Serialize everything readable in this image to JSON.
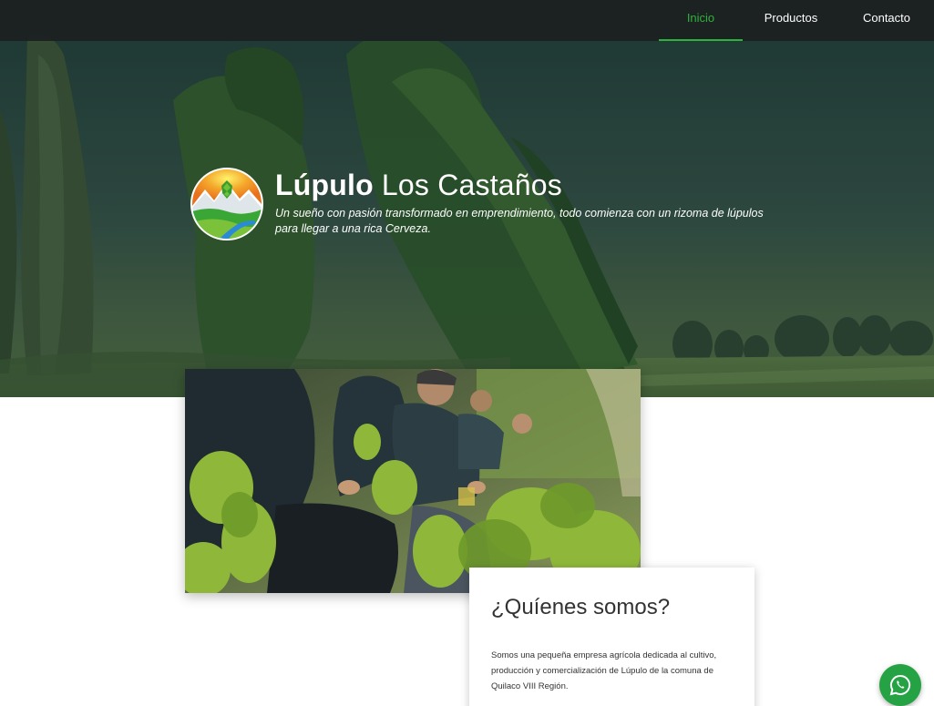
{
  "nav": {
    "items": [
      {
        "label": "Inicio",
        "active": true
      },
      {
        "label": "Productos",
        "active": false
      },
      {
        "label": "Contacto",
        "active": false
      }
    ]
  },
  "hero": {
    "title_bold": "Lúpulo",
    "title_rest": " Los Castaños",
    "tagline": "Un sueño con pasión transformado en emprendimiento, todo comienza con un rizoma de lúpulos para llegar a una rica Cerveza.",
    "logo_icon": "hop-mountain-logo"
  },
  "about": {
    "heading": "¿Quíenes somos?",
    "text": "Somos una pequeña empresa agrícola dedicada al cultivo, producción y comercialización de Lúpulo de la comuna de Quilaco VIII Región."
  },
  "colors": {
    "accent": "#2eb33a",
    "navbar": "#1c1f21",
    "whatsapp": "#25a244"
  },
  "floating": {
    "icon": "whatsapp-icon"
  }
}
